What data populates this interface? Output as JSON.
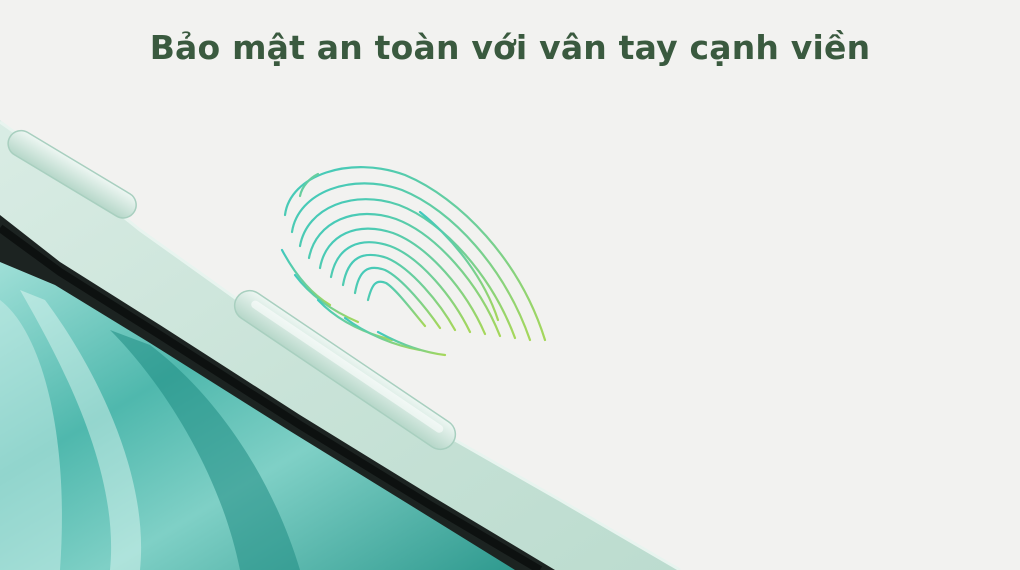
{
  "headline": {
    "text": "Bảo mật an toàn với vân tay cạnh viền"
  },
  "colors": {
    "background": "#f2f2f0",
    "headline": "#3a5a3f",
    "device_frame": "#cfe6dc",
    "screen_bezel": "#1c2321",
    "screen_teal": "#5fc2b9",
    "fingerprint_teal": "#3fc9be",
    "fingerprint_green": "#a6d75a"
  }
}
